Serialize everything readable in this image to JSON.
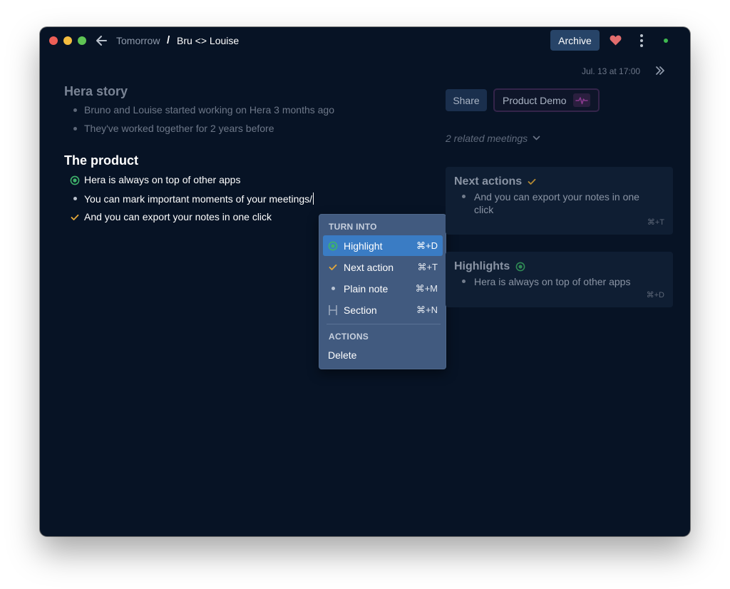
{
  "titlebar": {
    "back_icon": "arrow-left-icon",
    "breadcrumb_parent": "Tomorrow",
    "breadcrumb_separator": "/",
    "breadcrumb_current": "Bru <> Louise",
    "archive_label": "Archive",
    "favorite_icon": "heart-icon",
    "more_icon": "kebab-menu-icon",
    "status": "online",
    "colors": {
      "heart": "#e26d6d",
      "status": "#3fb950",
      "archive_bg": "#274468"
    }
  },
  "meta": {
    "date": "Jul. 13 at 17:00",
    "collapse_icon": "double-chevron-right-icon"
  },
  "notes": {
    "sections": [
      {
        "title": "Hera story",
        "items": [
          {
            "type": "plain",
            "text": "Bruno and Louise started working on Hera 3 months ago"
          },
          {
            "type": "plain",
            "text": "They've worked together for 2 years before"
          }
        ]
      },
      {
        "title": "The product",
        "items": [
          {
            "type": "highlight",
            "text": "Hera is always on top of other apps"
          },
          {
            "type": "plain",
            "text": "You can mark important moments of your meetings/"
          },
          {
            "type": "next_action",
            "text": "And you can export your notes in one click"
          }
        ]
      }
    ]
  },
  "context_menu": {
    "turn_into_header": "TURN INTO",
    "items": [
      {
        "label": "Highlight",
        "shortcut": "⌘+D",
        "icon": "highlight-target-icon",
        "active": true
      },
      {
        "label": "Next action",
        "shortcut": "⌘+T",
        "icon": "checkmark-icon",
        "active": false
      },
      {
        "label": "Plain note",
        "shortcut": "⌘+M",
        "icon": "bullet-icon",
        "active": false
      },
      {
        "label": "Section",
        "shortcut": "⌘+N",
        "icon": "heading-h-icon",
        "active": false
      }
    ],
    "actions_header": "ACTIONS",
    "delete_label": "Delete"
  },
  "side_panel": {
    "share_label": "Share",
    "meeting_type_label": "Product Demo",
    "meeting_type_icon": "pulse-icon",
    "related_meetings": "2 related meetings",
    "cards": [
      {
        "title": "Next actions",
        "icon": "checkmark-icon",
        "items": [
          "And you can export your notes in one click"
        ],
        "shortcut": "⌘+T"
      },
      {
        "title": "Highlights",
        "icon": "highlight-target-icon",
        "items": [
          "Hera is always on top of other apps"
        ],
        "shortcut": "⌘+D"
      }
    ]
  },
  "colors": {
    "background": "#071325",
    "highlight_green": "#3fb36b",
    "next_action_yellow": "#e5a83a",
    "menu_bg": "#415a7f",
    "menu_active": "#3a7cc4",
    "demo_accent": "#8a3a8f"
  }
}
